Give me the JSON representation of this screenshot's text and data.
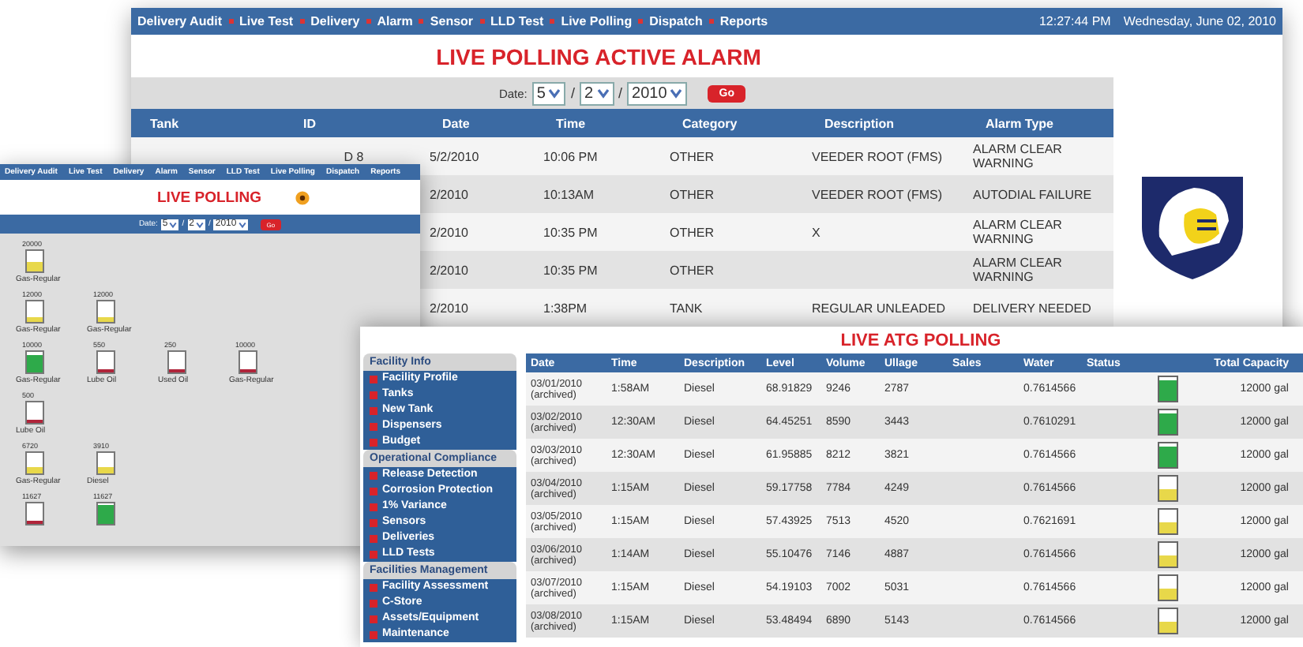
{
  "alarm_window": {
    "nav": [
      "Delivery Audit",
      "Live Test",
      "Delivery",
      "Alarm",
      "Sensor",
      "LLD Test",
      "Live Polling",
      "Dispatch",
      "Reports"
    ],
    "clock": "12:27:44 PM",
    "date_text": "Wednesday, June 02, 2010",
    "title": "LIVE POLLING ACTIVE ALARM",
    "date_filter": {
      "label": "Date:",
      "parts": [
        {
          "kind": "select",
          "text": "5"
        },
        {
          "kind": "sep",
          "text": "/"
        },
        {
          "kind": "select",
          "text": "2"
        },
        {
          "kind": "sep",
          "text": "/"
        },
        {
          "kind": "select",
          "text": "2010"
        }
      ],
      "go": "Go"
    },
    "columns": [
      "Tank",
      "ID",
      "Date",
      "Time",
      "Category",
      "Description",
      "Alarm Type"
    ],
    "rows": [
      {
        "id": "D 8",
        "date": "5/2/2010",
        "time": "10:06 PM",
        "category": "OTHER",
        "description": "VEEDER ROOT (FMS)",
        "alarm_type": "ALARM CLEAR WARNING"
      },
      {
        "date": "2/2010",
        "time": "10:13AM",
        "category": "OTHER",
        "description": "VEEDER ROOT (FMS)",
        "alarm_type": "AUTODIAL FAILURE"
      },
      {
        "date": "2/2010",
        "time": "10:35 PM",
        "category": "OTHER",
        "description": "X",
        "alarm_type": "ALARM CLEAR WARNING"
      },
      {
        "date": "2/2010",
        "time": "10:35 PM",
        "category": "OTHER",
        "alarm_type": "ALARM CLEAR WARNING"
      },
      {
        "date": "2/2010",
        "time": "1:38PM",
        "category": "TANK",
        "description": "REGULAR UNLEADED",
        "alarm_type": "DELIVERY NEEDED"
      }
    ]
  },
  "polling_window": {
    "nav": [
      "Delivery Audit",
      "Live Test",
      "Delivery",
      "Alarm",
      "Sensor",
      "LLD Test",
      "Live Polling",
      "Dispatch",
      "Reports"
    ],
    "title": "LIVE POLLING",
    "date_filter": {
      "label": "Date:",
      "parts": [
        {
          "kind": "select",
          "text": "5"
        },
        {
          "kind": "sep",
          "text": "/"
        },
        {
          "kind": "select",
          "text": "2"
        },
        {
          "kind": "sep",
          "text": "/"
        },
        {
          "kind": "select",
          "text": "2010"
        }
      ],
      "go": "Go"
    },
    "tank_rows": [
      [
        {
          "capacity": "20000",
          "label": "Gas-Regular",
          "level": 0.45,
          "color": "#e8d84a"
        }
      ],
      [
        {
          "capacity": "12000",
          "label": "Gas-Regular",
          "level": 0.2,
          "color": "#e8d84a"
        },
        {
          "capacity": "12000",
          "label": "Gas-Regular",
          "level": 0.2,
          "color": "#e8d84a"
        }
      ],
      [
        {
          "capacity": "10000",
          "label": "Gas-Regular",
          "level": 0.85,
          "color": "#2eaa4a"
        },
        {
          "capacity": "550",
          "label": "Lube Oil",
          "level": 0.12,
          "color": "#b0243a"
        },
        {
          "capacity": "250",
          "label": "Used Oil",
          "level": 0.12,
          "color": "#b0243a"
        },
        {
          "capacity": "10000",
          "label": "Gas-Regular",
          "level": 0.12,
          "color": "#b0243a"
        }
      ],
      [
        {
          "capacity": "500",
          "label": "Lube Oil",
          "level": 0.12,
          "color": "#b0243a"
        }
      ],
      [
        {
          "capacity": "6720",
          "label": "Gas-Regular",
          "level": 0.3,
          "color": "#e8d84a"
        },
        {
          "capacity": "3910",
          "label": "Diesel",
          "level": 0.3,
          "color": "#e8d84a"
        }
      ],
      [
        {
          "capacity": "11627",
          "level": 0.12,
          "color": "#b0243a"
        },
        {
          "capacity": "11627",
          "level": 0.9,
          "color": "#2eaa4a"
        }
      ]
    ]
  },
  "atg_window": {
    "title": "LIVE ATG POLLING",
    "sidebar": [
      {
        "heading": "Facility Info",
        "items": [
          "Facility Profile",
          "Tanks",
          "New Tank",
          "Dispensers",
          "Budget"
        ]
      },
      {
        "heading": "Operational Compliance",
        "items": [
          "Release Detection",
          "Corrosion Protection",
          "1% Variance",
          "Sensors",
          "Deliveries",
          "LLD Tests"
        ]
      },
      {
        "heading": "Facilities Management",
        "items": [
          "Facility Assessment",
          "C-Store",
          "Assets/Equipment",
          "Maintenance"
        ]
      }
    ],
    "columns": [
      "Date",
      "Time",
      "Description",
      "Level",
      "Volume",
      "Ullage",
      "Sales",
      "Water",
      "Status",
      "Total Capacity"
    ],
    "rows": [
      {
        "date": "03/01/2010",
        "note": "(archived)",
        "time": "1:58AM",
        "description": "Diesel",
        "level_value": "68.91829",
        "volume": "9246",
        "ullage": "2787",
        "water": "0.7614566",
        "tank": {
          "level": 0.85,
          "color": "#2eaa4a"
        },
        "capacity": "12000 gal"
      },
      {
        "date": "03/02/2010",
        "note": "(archived)",
        "time": "12:30AM",
        "description": "Diesel",
        "level_value": "64.45251",
        "volume": "8590",
        "ullage": "3443",
        "water": "0.7610291",
        "tank": {
          "level": 0.85,
          "color": "#2eaa4a"
        },
        "capacity": "12000 gal"
      },
      {
        "date": "03/03/2010",
        "note": "(archived)",
        "time": "12:30AM",
        "description": "Diesel",
        "level_value": "61.95885",
        "volume": "8212",
        "ullage": "3821",
        "water": "0.7614566",
        "tank": {
          "level": 0.85,
          "color": "#2eaa4a"
        },
        "capacity": "12000 gal"
      },
      {
        "date": "03/04/2010",
        "note": "(archived)",
        "time": "1:15AM",
        "description": "Diesel",
        "level_value": "59.17758",
        "volume": "7784",
        "ullage": "4249",
        "water": "0.7614566",
        "tank": {
          "level": 0.5,
          "color": "#e8d84a"
        },
        "capacity": "12000 gal"
      },
      {
        "date": "03/05/2010",
        "note": "(archived)",
        "time": "1:15AM",
        "description": "Diesel",
        "level_value": "57.43925",
        "volume": "7513",
        "ullage": "4520",
        "water": "0.7621691",
        "tank": {
          "level": 0.5,
          "color": "#e8d84a"
        },
        "capacity": "12000 gal"
      },
      {
        "date": "03/06/2010",
        "note": "(archived)",
        "time": "1:14AM",
        "description": "Diesel",
        "level_value": "55.10476",
        "volume": "7146",
        "ullage": "4887",
        "water": "0.7614566",
        "tank": {
          "level": 0.5,
          "color": "#e8d84a"
        },
        "capacity": "12000 gal"
      },
      {
        "date": "03/07/2010",
        "note": "(archived)",
        "time": "1:15AM",
        "description": "Diesel",
        "level_value": "54.19103",
        "volume": "7002",
        "ullage": "5031",
        "water": "0.7614566",
        "tank": {
          "level": 0.5,
          "color": "#e8d84a"
        },
        "capacity": "12000 gal"
      },
      {
        "date": "03/08/2010",
        "note": "(archived)",
        "time": "1:15AM",
        "description": "Diesel",
        "level_value": "53.48494",
        "volume": "6890",
        "ullage": "5143",
        "water": "0.7614566",
        "tank": {
          "level": 0.5,
          "color": "#e8d84a"
        },
        "capacity": "12000 gal"
      }
    ]
  }
}
